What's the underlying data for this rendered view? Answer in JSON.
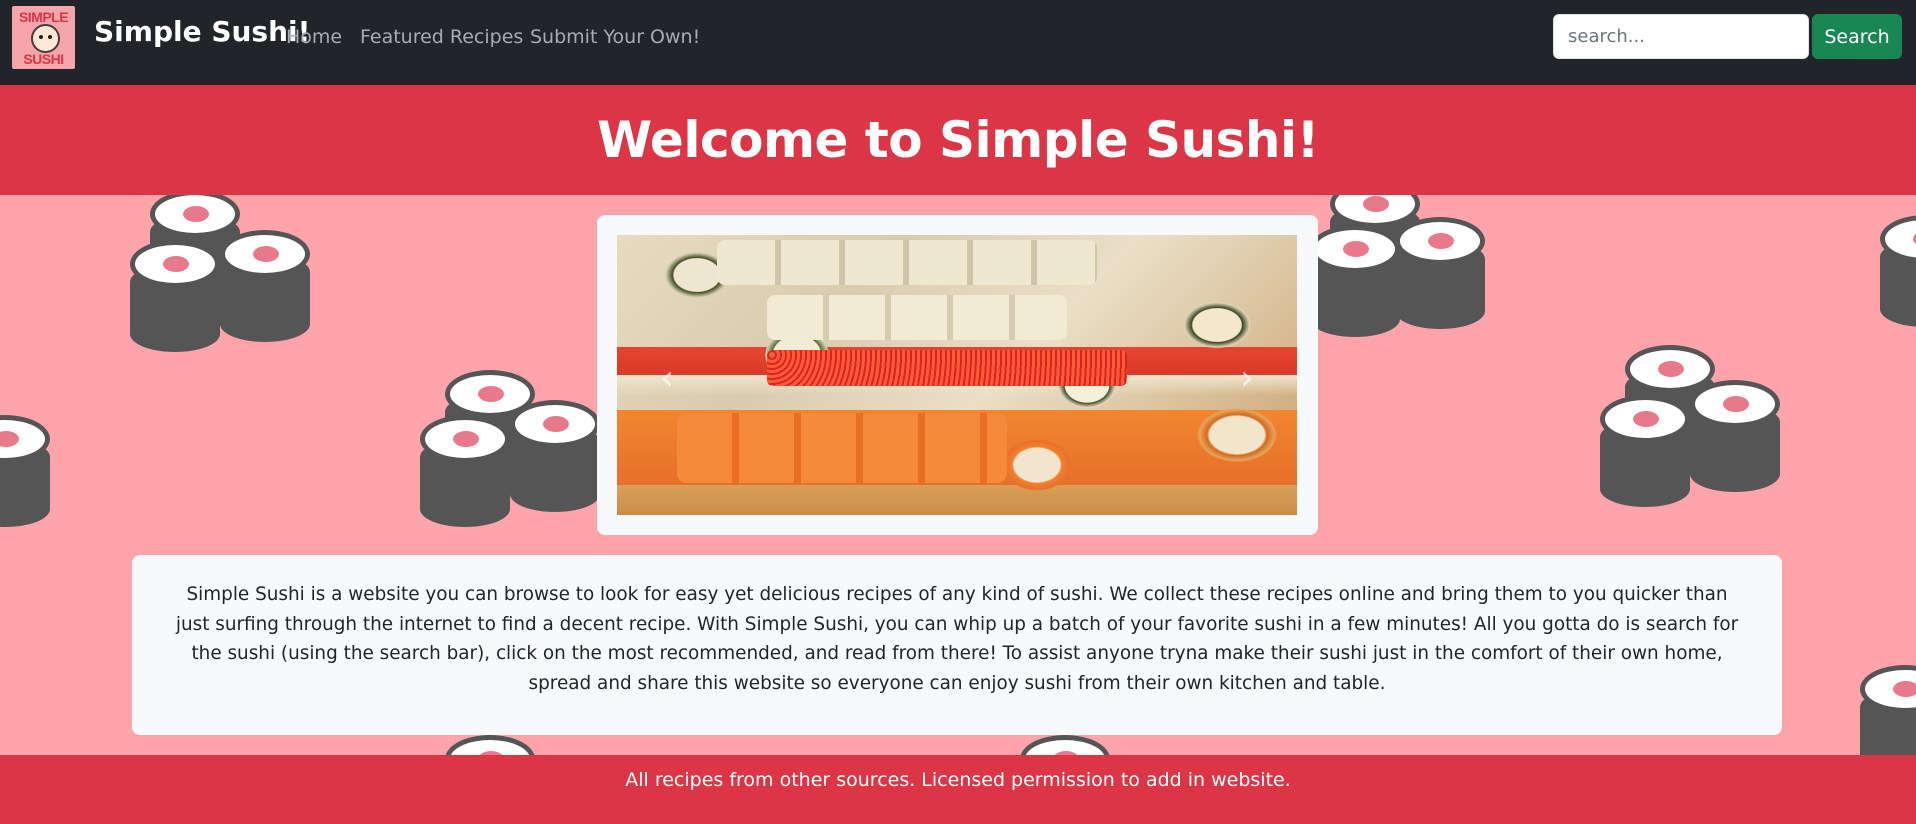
{
  "navbar": {
    "logo": {
      "top_text": "SIMPLE",
      "bottom_text": "SUSHI"
    },
    "brand": "Simple Sushi!",
    "links": [
      "Home",
      "Featured Recipes",
      "Submit Your Own!"
    ],
    "search": {
      "placeholder": "search...",
      "value": "",
      "button_label": "Search"
    }
  },
  "hero": {
    "title": "Welcome to Simple Sushi!"
  },
  "carousel": {
    "prev_glyph": "‹",
    "next_glyph": "›"
  },
  "description": "Simple Sushi is a website you can browse to look for easy yet delicious recipes of any kind of sushi. We collect these recipes online and bring them to you quicker than just surfing through the internet to find a decent recipe. With Simple Sushi, you can whip up a batch of your favorite sushi in a few minutes! All you gotta do is search for the sushi (using the search bar), click on the most recommended, and read from there! To assist anyone tryna make their sushi just in the comfort of their own home, spread and share this website so everyone can enjoy sushi from their own kitchen and table.",
  "footer": {
    "text": "All recipes from other sources. Licensed permission to add in website."
  },
  "colors": {
    "navbar_bg": "#212529",
    "accent_red": "#dc3545",
    "search_button": "#198754",
    "background_pink": "#ffa4ab",
    "card_bg": "#f8f9fa"
  }
}
